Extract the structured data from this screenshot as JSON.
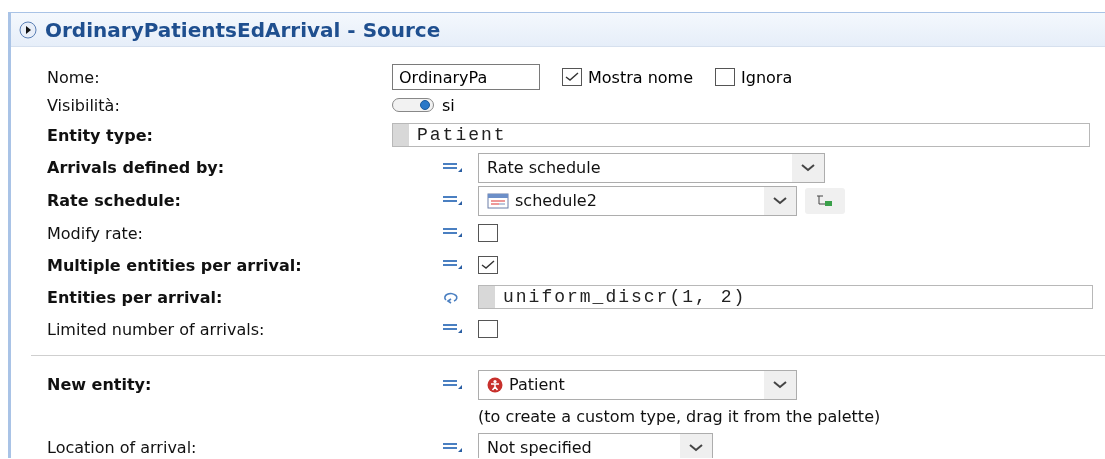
{
  "window": {
    "title": "OrdinaryPatientsEdArrival - Source"
  },
  "rows": [
    {
      "kind": "name",
      "label": "Nome:",
      "bold": false,
      "value": "OrdinaryPa",
      "options": [
        {
          "label": "Mostra nome",
          "checked": true
        },
        {
          "label": "Ignora",
          "checked": false
        }
      ]
    },
    {
      "kind": "toggle",
      "label": "Visibilità:",
      "bold": false,
      "on": true,
      "value": "si"
    },
    {
      "kind": "code",
      "label": "Entity type:",
      "bold": true,
      "value": "Patient"
    },
    {
      "kind": "dropdown",
      "label": "Arrivals defined by:",
      "bold": true,
      "editor": {
        "kind": "static"
      },
      "value": "Rate schedule"
    },
    {
      "kind": "dropdown",
      "label": "Rate schedule:",
      "bold": true,
      "editor": {
        "kind": "static"
      },
      "item_icon": {
        "kind": "schedule"
      },
      "value": "schedule2",
      "side_button": true
    },
    {
      "kind": "checkbox",
      "label": "Modify rate:",
      "bold": false,
      "editor": {
        "kind": "static"
      },
      "checked": false
    },
    {
      "kind": "checkbox",
      "label": "Multiple entities per arrival:",
      "bold": true,
      "editor": {
        "kind": "static"
      },
      "checked": true
    },
    {
      "kind": "code",
      "label": "Entities per arrival:",
      "bold": true,
      "editor": {
        "kind": "dynamic"
      },
      "value": "uniform_discr(1, 2)"
    },
    {
      "kind": "checkbox",
      "label": "Limited number of arrivals:",
      "bold": false,
      "editor": {
        "kind": "static"
      },
      "checked": false
    },
    {
      "kind": "divider"
    },
    {
      "kind": "dropdown",
      "label": "New entity:",
      "bold": true,
      "editor": {
        "kind": "static"
      },
      "item_icon": {
        "kind": "entity"
      },
      "value": "Patient"
    },
    {
      "kind": "note",
      "value": "(to create a custom type, drag it from the palette)"
    },
    {
      "kind": "dropdown",
      "label": "Location of arrival:",
      "bold": false,
      "editor": {
        "kind": "static"
      },
      "value": "Not specified"
    }
  ]
}
